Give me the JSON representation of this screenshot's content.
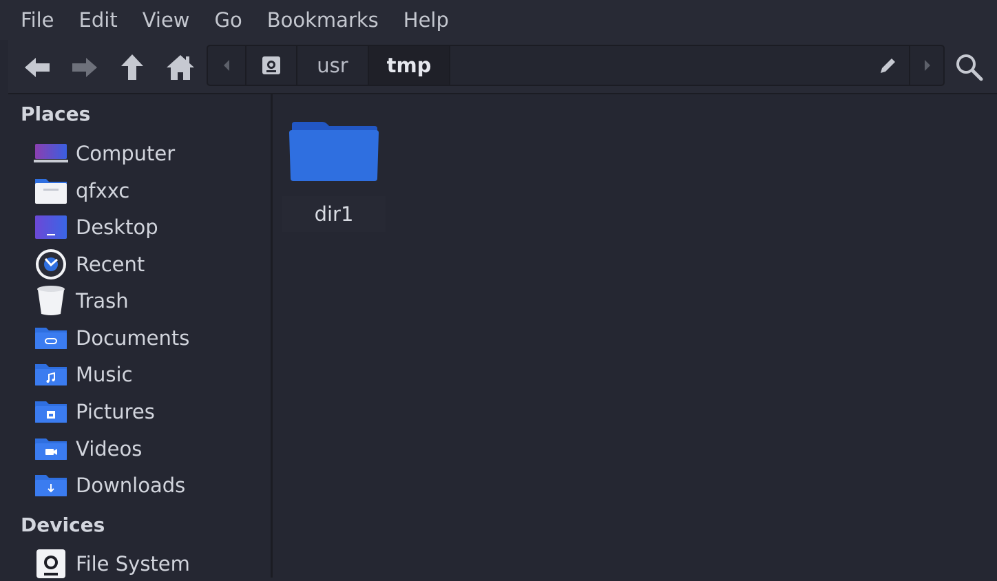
{
  "menu": [
    "File",
    "Edit",
    "View",
    "Go",
    "Bookmarks",
    "Help"
  ],
  "toolbar": {
    "icons": [
      "back-arrow-icon",
      "forward-arrow-icon",
      "up-arrow-icon",
      "home-icon",
      "search-icon"
    ]
  },
  "pathbar": {
    "segments": [
      "usr",
      "tmp"
    ],
    "active": "tmp",
    "icons": [
      "path-scroll-left-icon",
      "root-drive-icon",
      "edit-location-icon",
      "path-scroll-right-icon"
    ]
  },
  "sidebar": {
    "places_title": "Places",
    "places": [
      {
        "label": "Computer",
        "icon": "computer-icon"
      },
      {
        "label": "qfxxc",
        "icon": "home-folder-icon"
      },
      {
        "label": "Desktop",
        "icon": "desktop-icon"
      },
      {
        "label": "Recent",
        "icon": "recent-clock-icon"
      },
      {
        "label": "Trash",
        "icon": "trash-icon"
      },
      {
        "label": "Documents",
        "icon": "documents-folder-icon"
      },
      {
        "label": "Music",
        "icon": "music-folder-icon"
      },
      {
        "label": "Pictures",
        "icon": "pictures-folder-icon"
      },
      {
        "label": "Videos",
        "icon": "videos-folder-icon"
      },
      {
        "label": "Downloads",
        "icon": "downloads-folder-icon"
      }
    ],
    "devices_title": "Devices",
    "devices": [
      {
        "label": "File System",
        "icon": "drive-icon"
      }
    ]
  },
  "main": {
    "files": [
      {
        "name": "dir1",
        "icon": "folder-icon"
      }
    ]
  },
  "colors": {
    "background": "#252732",
    "bar": "#282a35",
    "folder_blue": "#2f6fe0",
    "text": "#d2d5dd"
  }
}
